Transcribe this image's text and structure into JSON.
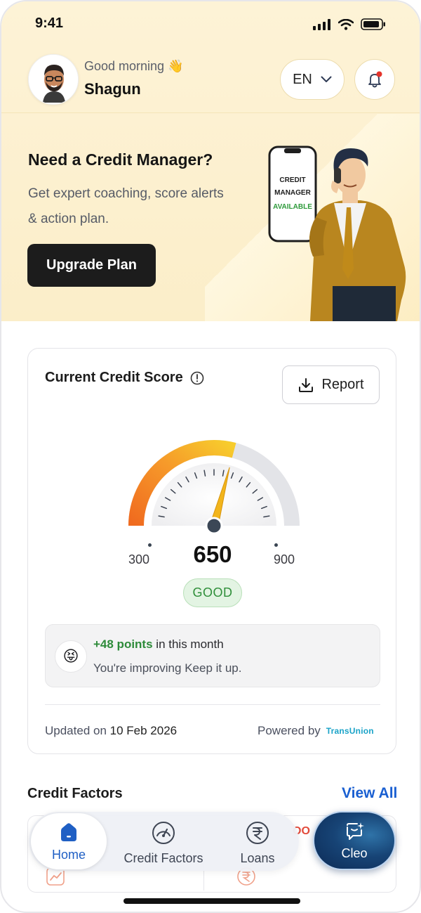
{
  "status_bar": {
    "time": "9:41"
  },
  "header": {
    "greeting": "Good morning",
    "greeting_emoji": "👋",
    "user_name": "Shagun",
    "language": "EN"
  },
  "promo": {
    "title": "Need a Credit Manager?",
    "subtitle": "Get expert coaching, score alerts & action plan.",
    "cta": "Upgrade Plan",
    "phone_lines": [
      "CREDIT",
      "MANAGER",
      "AVAILABLE"
    ]
  },
  "credit_card": {
    "title": "Current Credit Score",
    "report_label": "Report",
    "score": "650",
    "min": "300",
    "max": "900",
    "rating": "GOOD",
    "change_points": "+48 points",
    "change_period": "in this month",
    "message": "You're improving Keep it up.",
    "updated_prefix": "Updated on",
    "updated_date": "10 Feb 2026",
    "powered_by": "Powered by",
    "bureau": "TransUnion",
    "gauge_fraction": 0.583
  },
  "factors": {
    "title": "Credit Factors",
    "view_all": "View All",
    "peek_text": "OO"
  },
  "bottom_nav": {
    "items": [
      {
        "label": "Home",
        "icon": "home-icon",
        "active": true
      },
      {
        "label": "Credit Factors",
        "icon": "speedometer-icon",
        "active": false
      },
      {
        "label": "Loans",
        "icon": "rupee-icon",
        "active": false
      }
    ],
    "assistant": {
      "label": "Cleo",
      "icon": "chat-sparkle-icon"
    }
  },
  "colors": {
    "accent_blue": "#1a5fd1",
    "good_green": "#2f8f3a",
    "hero_bg": "#fdf3d6",
    "gauge_orange": "#f27a21",
    "gauge_yellow": "#f7c12b"
  }
}
